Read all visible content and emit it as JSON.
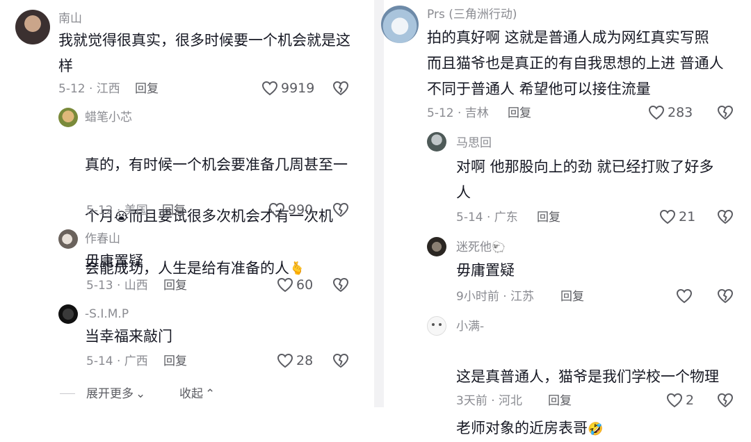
{
  "left": {
    "c1": {
      "name": "南山",
      "text": "我就觉得很真实，很多时候要一个机会就是这\n样",
      "date_loc": "5-12 · 江西",
      "reply": "回复",
      "likes": "9919"
    },
    "c2": {
      "name": "蜡笔小芯",
      "text1": "真的，有时候一个机会要准备几周甚至一",
      "text2a": "个月",
      "emoji2": "😭",
      "text2b": "而且要试很多次机会才有一次机",
      "text3": "会能成功，人生是给有准备的人",
      "emoji3": "🫰",
      "date_loc": "5-12 · 美国",
      "reply": "回复",
      "likes": "990"
    },
    "c3": {
      "name": "作春山",
      "text": "毋庸置疑",
      "date_loc": "5-13 · 山西",
      "reply": "回复",
      "likes": "60"
    },
    "c4": {
      "name": "-S.I.M.P",
      "text": "当幸福来敲门",
      "date_loc": "5-14 · 广西",
      "reply": "回复",
      "likes": "28"
    },
    "expand_label": "展开更多",
    "collapse_label": "收起"
  },
  "right": {
    "c1": {
      "name": "Prs (三角洲行动)",
      "text": "拍的真好啊 这就是普通人成为网红真实写照\n而且猫爷也是真正的有自我思想的上进 普通人\n不同于普通人 希望他可以接住流量",
      "date_loc": "5-12 · 吉林",
      "reply": "回复",
      "likes": "283"
    },
    "c2": {
      "name": "马思回",
      "text": "对啊 他那股向上的劲 就已经打败了好多\n人",
      "date_loc": "5-14 · 广东",
      "reply": "回复",
      "likes": "21"
    },
    "c3": {
      "name": "迷死他",
      "name_emoji": "🐑",
      "text": "毋庸置疑",
      "date_loc": "9小时前 · 江苏",
      "reply": "回复",
      "likes": ""
    },
    "c4": {
      "name": "小满-",
      "text1": "这是真普通人，猫爷是我们学校一个物理",
      "text2": "老师对象的近房表哥",
      "emoji2": "🤣",
      "date_loc": "3天前 · 河北",
      "reply": "回复",
      "likes": "2"
    }
  },
  "colors": {
    "text": "#161823",
    "meta": "#8a8b91",
    "icon": "#5b5c62"
  }
}
